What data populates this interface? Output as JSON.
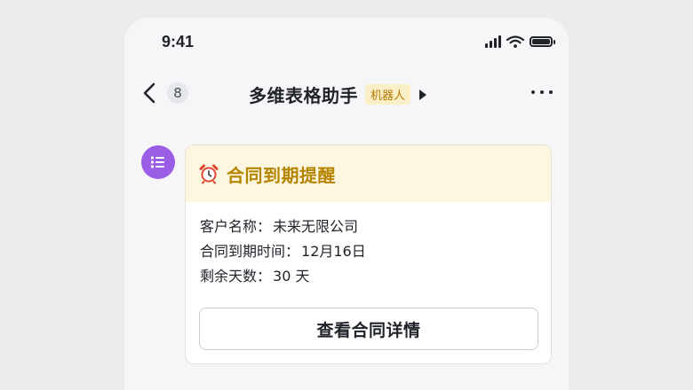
{
  "status_bar": {
    "time": "9:41",
    "icons": [
      "signal-icon",
      "wifi-icon",
      "battery-icon"
    ]
  },
  "nav": {
    "back_icon": "chevron-left-icon",
    "unread_count": "8",
    "title": "多维表格助手",
    "bot_tag": "机器人",
    "more_icon": "more-dots-icon"
  },
  "message": {
    "avatar_icon": "list-icon",
    "avatar_color": "#9b5de5",
    "card": {
      "header_icon": "alarm-clock-icon",
      "title": "合同到期提醒",
      "header_color": "#fdf6e0",
      "title_color": "#b58500",
      "fields": [
        {
          "label": "客户名称：",
          "value": "未来无限公司"
        },
        {
          "label": "合同到期时间：",
          "value": "12月16日"
        },
        {
          "label": "剩余天数：",
          "value": "30 天"
        }
      ],
      "button_label": "查看合同详情"
    }
  }
}
